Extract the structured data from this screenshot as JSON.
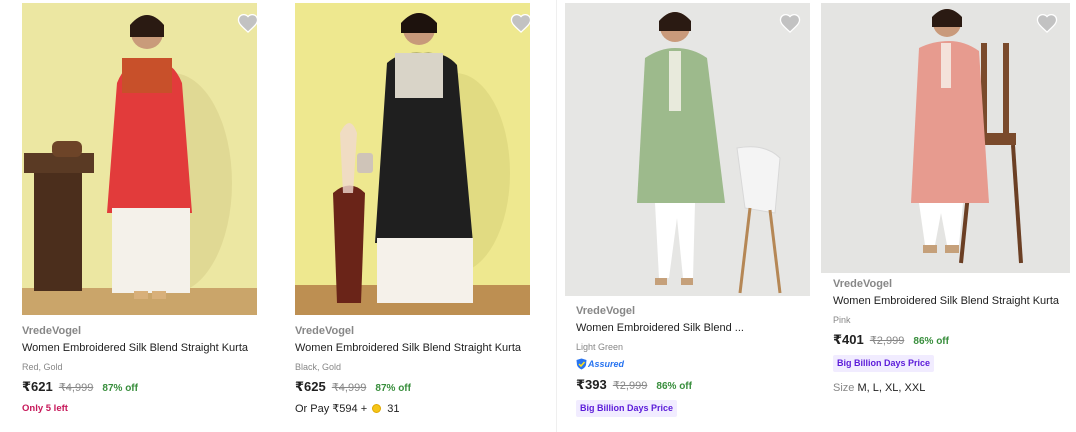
{
  "colors": {
    "brand_grey": "#878787",
    "text": "#212121",
    "discount_green": "#388e3c",
    "stock_pink": "#c7185a",
    "assured_blue": "#2874f0",
    "offer_purple": "#5b1bd9",
    "offer_bg": "#f1ecff"
  },
  "products": [
    {
      "brand": "VredeVogel",
      "title": "Women Embroidered Silk Blend Straight Kurta",
      "color": "Red, Gold",
      "price": "₹621",
      "mrp": "₹4,999",
      "discount": "87% off",
      "stock_note": "Only 5 left",
      "wishlist_icon": "heart-icon"
    },
    {
      "brand": "VredeVogel",
      "title": "Women Embroidered Silk Blend Straight Kurta",
      "color": "Black, Gold",
      "price": "₹625",
      "mrp": "₹4,999",
      "discount": "87% off",
      "pay_prefix": "Or Pay ₹594 +",
      "coins": "31",
      "wishlist_icon": "heart-icon"
    },
    {
      "brand": "VredeVogel",
      "title": "Women Embroidered Silk Blend ...",
      "color": "Light Green",
      "assured_label": "Assured",
      "price": "₹393",
      "mrp": "₹2,999",
      "discount": "86% off",
      "offer_tag": "Big Billion Days Price",
      "wishlist_icon": "heart-icon"
    },
    {
      "brand": "VredeVogel",
      "title": "Women Embroidered Silk Blend Straight Kurta",
      "color": "Pink",
      "price": "₹401",
      "mrp": "₹2,999",
      "discount": "86% off",
      "offer_tag": "Big Billion Days Price",
      "size_label": "Size",
      "sizes": "M, L, XL, XXL",
      "wishlist_icon": "heart-icon"
    }
  ]
}
